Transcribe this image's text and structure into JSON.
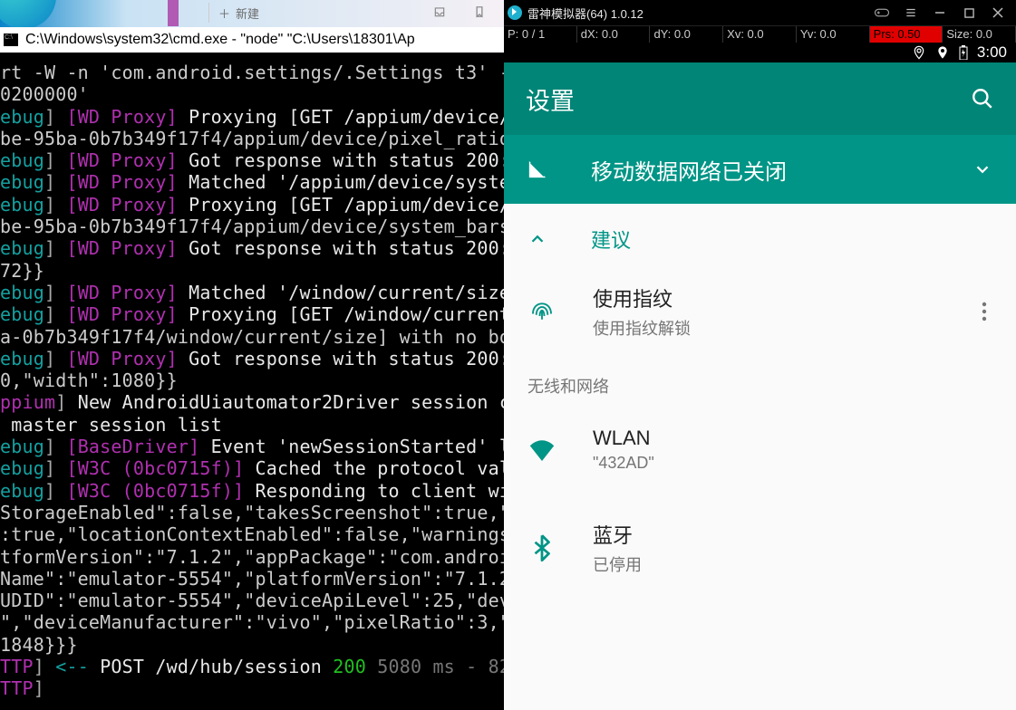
{
  "top_strip": {
    "new_label": "新建",
    "plus": "＋"
  },
  "cmd": {
    "title": "C:\\Windows\\system32\\cmd.exe - \"node\"  \"C:\\Users\\18301\\Ap"
  },
  "terminal_lines": [
    [
      [
        "pale",
        "rt -W -n 'com.android.settings/.Settings t3' -"
      ]
    ],
    [
      [
        "pale",
        "0200000'"
      ]
    ],
    [
      [
        "teal",
        "ebug"
      ],
      [
        "gray",
        "] "
      ],
      [
        "mag",
        "[WD Proxy]"
      ],
      [
        "white",
        " Proxying [GET /appium/device/"
      ]
    ],
    [
      [
        "pale",
        "be-95ba-0b7b349f17f4/appium/device/pixel_ratio"
      ]
    ],
    [
      [
        "teal",
        "ebug"
      ],
      [
        "gray",
        "] "
      ],
      [
        "mag",
        "[WD Proxy]"
      ],
      [
        "white",
        " Got response with status 200:"
      ]
    ],
    [
      [
        "teal",
        "ebug"
      ],
      [
        "gray",
        "] "
      ],
      [
        "mag",
        "[WD Proxy]"
      ],
      [
        "white",
        " Matched '/appium/device/syste"
      ]
    ],
    [
      [
        "teal",
        "ebug"
      ],
      [
        "gray",
        "] "
      ],
      [
        "mag",
        "[WD Proxy]"
      ],
      [
        "white",
        " Proxying [GET /appium/device/"
      ]
    ],
    [
      [
        "pale",
        "be-95ba-0b7b349f17f4/appium/device/system_bars"
      ]
    ],
    [
      [
        "teal",
        "ebug"
      ],
      [
        "gray",
        "] "
      ],
      [
        "mag",
        "[WD Proxy]"
      ],
      [
        "white",
        " Got response with status 200:"
      ]
    ],
    [
      [
        "pale",
        "72}}"
      ]
    ],
    [
      [
        "teal",
        "ebug"
      ],
      [
        "gray",
        "] "
      ],
      [
        "mag",
        "[WD Proxy]"
      ],
      [
        "white",
        " Matched '/window/current/size"
      ]
    ],
    [
      [
        "teal",
        "ebug"
      ],
      [
        "gray",
        "] "
      ],
      [
        "mag",
        "[WD Proxy]"
      ],
      [
        "white",
        " Proxying [GET /window/current"
      ]
    ],
    [
      [
        "pale",
        "a-0b7b349f17f4/window/current/size] with no bo"
      ]
    ],
    [
      [
        "teal",
        "ebug"
      ],
      [
        "gray",
        "] "
      ],
      [
        "mag",
        "[WD Proxy]"
      ],
      [
        "white",
        " Got response with status 200:"
      ]
    ],
    [
      [
        "pale",
        "0,\"width\":1080}}"
      ]
    ],
    [
      [
        "mag",
        "ppium"
      ],
      [
        "gray",
        "] "
      ],
      [
        "white",
        "New AndroidUiautomator2Driver session c"
      ]
    ],
    [
      [
        "white",
        " master session list"
      ]
    ],
    [
      [
        "teal",
        "ebug"
      ],
      [
        "gray",
        "] "
      ],
      [
        "mag",
        "[BaseDriver]"
      ],
      [
        "white",
        " Event 'newSessionStarted' l"
      ]
    ],
    [
      [
        "teal",
        "ebug"
      ],
      [
        "gray",
        "] "
      ],
      [
        "mag",
        "[W3C (0bc0715f)]"
      ],
      [
        "white",
        " Cached the protocol val"
      ]
    ],
    [
      [
        "teal",
        "ebug"
      ],
      [
        "gray",
        "] "
      ],
      [
        "mag",
        "[W3C (0bc0715f)]"
      ],
      [
        "white",
        " Responding to client wi"
      ]
    ],
    [
      [
        "pale",
        "StorageEnabled\":false,\"takesScreenshot\":true,\""
      ]
    ],
    [
      [
        "pale",
        ":true,\"locationContextEnabled\":false,\"warnings"
      ]
    ],
    [
      [
        "pale",
        "tformVersion\":\"7.1.2\",\"appPackage\":\"com.androi"
      ]
    ],
    [
      [
        "pale",
        "Name\":\"emulator-5554\",\"platformVersion\":\"7.1.2"
      ]
    ],
    [
      [
        "pale",
        "UDID\":\"emulator-5554\",\"deviceApiLevel\":25,\"dev"
      ]
    ],
    [
      [
        "pale",
        "\",\"deviceManufacturer\":\"vivo\",\"pixelRatio\":3,\""
      ]
    ],
    [
      [
        "pale",
        "1848}}}"
      ]
    ],
    [
      [
        "mag",
        "TTP"
      ],
      [
        "gray",
        "] "
      ],
      [
        "teal",
        "<--"
      ],
      [
        "white",
        " POST /wd/hub/session "
      ],
      [
        "green",
        "200"
      ],
      [
        "dim",
        " 5080 ms - 82"
      ]
    ],
    [
      [
        "mag",
        "TTP"
      ],
      [
        "gray",
        "]"
      ]
    ]
  ],
  "emulator": {
    "title": "雷神模拟器(64) 1.0.12",
    "debug": {
      "p": "P: 0 / 1",
      "dx": "dX: 0.0",
      "dy": "dY: 0.0",
      "xv": "Xv: 0.0",
      "yv": "Yv: 0.0",
      "prs": "Prs: 0.50",
      "size": "Size: 0.0"
    },
    "clock": "3:00"
  },
  "settings": {
    "title": "设置",
    "banner": "移动数据网络已关闭",
    "suggest_label": "建议",
    "fingerprint": {
      "title": "使用指纹",
      "subtitle": "使用指纹解锁"
    },
    "wireless_section": "无线和网络",
    "wlan": {
      "title": "WLAN",
      "subtitle": "\"432AD\""
    },
    "bluetooth": {
      "title": "蓝牙",
      "subtitle": "已停用"
    }
  }
}
